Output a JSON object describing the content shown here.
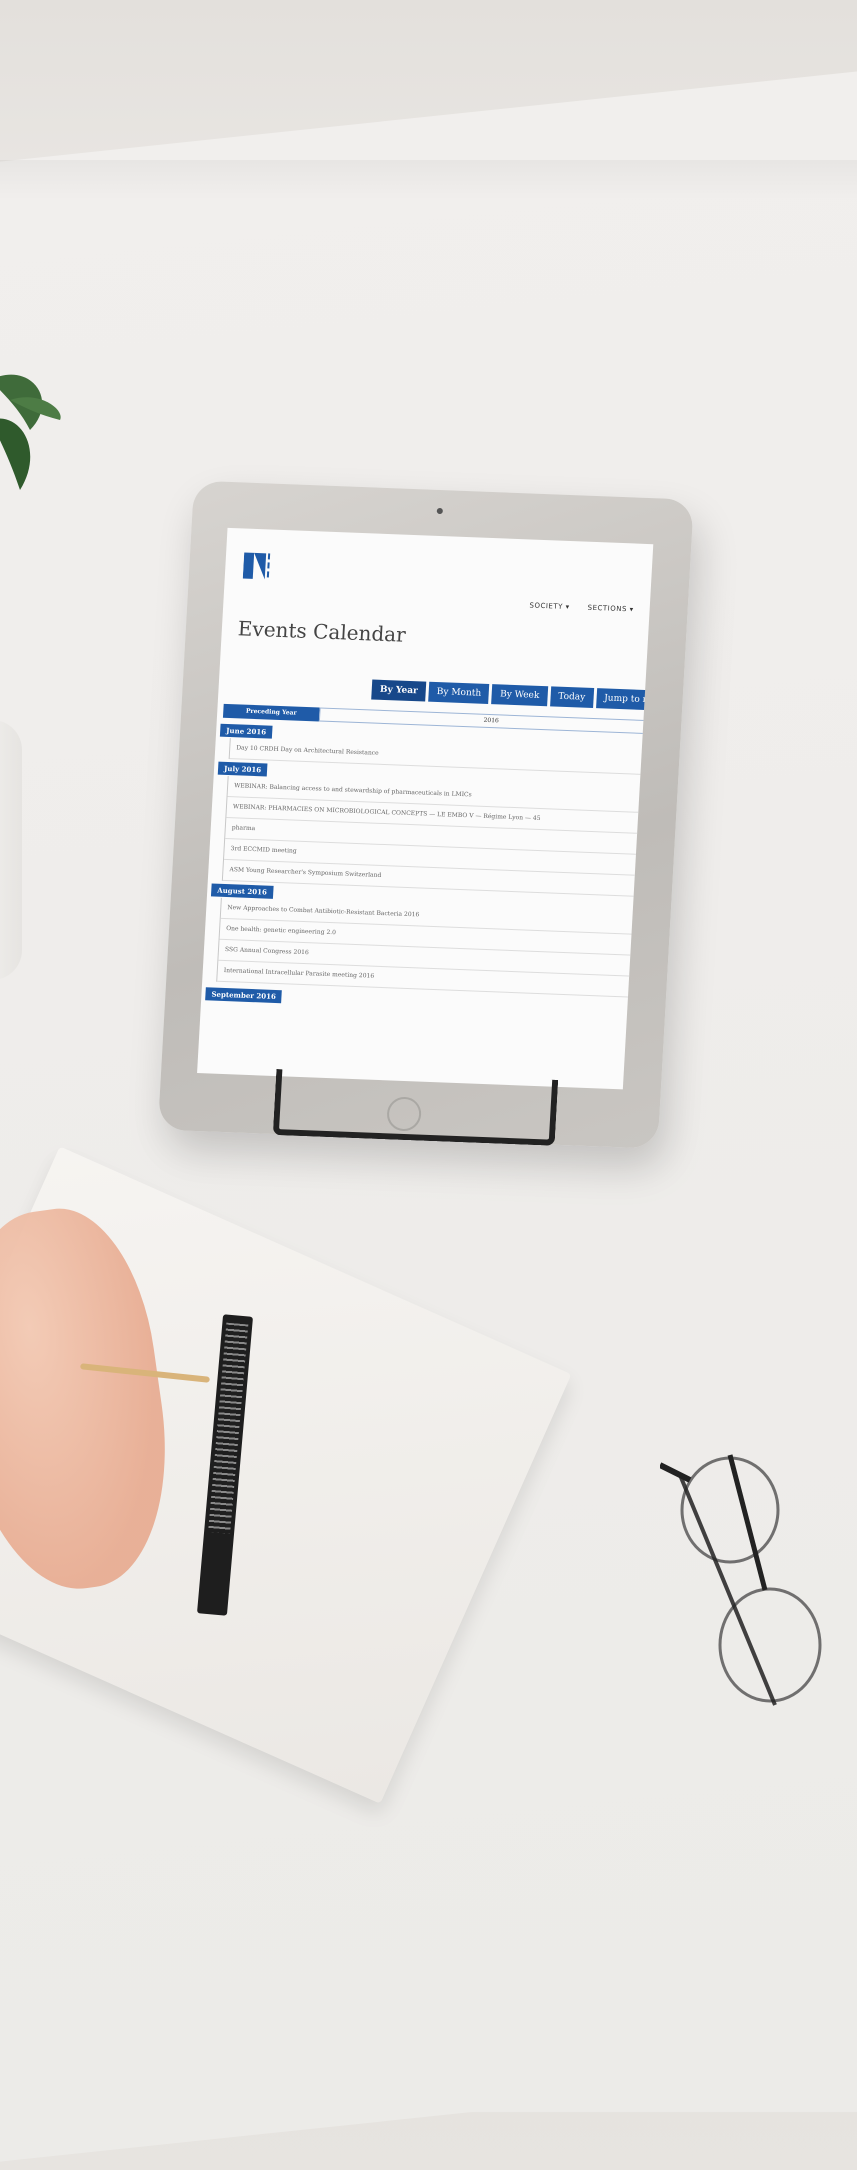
{
  "screen": {
    "nav": {
      "items": [
        "SOCIETY ▾",
        "SECTIONS ▾"
      ]
    },
    "page_title": "Events Calendar",
    "view_tabs": [
      "By Year",
      "By Month",
      "By Week",
      "Today",
      "Jump to mo"
    ],
    "year_header": {
      "left": "Preceding Year",
      "right": "2016"
    },
    "months": [
      {
        "label": "June 2016",
        "events": [
          "Day 10 CRDH Day on Architectural Resistance"
        ]
      },
      {
        "label": "July 2016",
        "events": [
          "WEBINAR: Balancing access to and stewardship of pharmaceuticals in LMICs",
          "WEBINAR: PHARMACIES ON MICROBIOLOGICAL CONCEPTS — LE EMBO V — Régime Lyon — 45",
          "pharma",
          "3rd ECCMID meeting",
          "ASM Young Researcher's Symposium Switzerland"
        ]
      },
      {
        "label": "August 2016",
        "events": [
          "New Approaches to Combat Antibiotic-Resistant Bacteria 2016",
          "One health: genetic engineering 2.0",
          "SSG Annual Congress 2016",
          "International Intracellular Parasite meeting 2016"
        ]
      },
      {
        "label": "September 2016",
        "events": []
      }
    ]
  }
}
